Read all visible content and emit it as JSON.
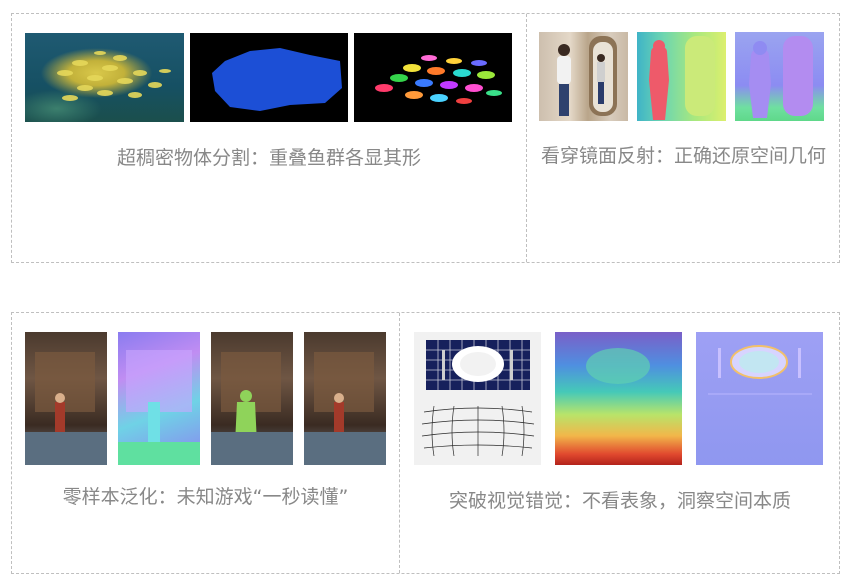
{
  "panels": {
    "dense_segmentation": {
      "caption": "超稠密物体分割：重叠鱼群各显其形"
    },
    "mirror_geometry": {
      "caption": "看穿镜面反射：正确还原空间几何"
    },
    "zero_shot_game": {
      "caption": "零样本泛化：未知游戏“一秒读懂”"
    },
    "visual_illusion": {
      "caption": "突破视觉错觉：不看表象，洞察空间本质"
    }
  },
  "colors": {
    "caption_text": "#888888",
    "border": "#bfbfbf",
    "background": "#ffffff"
  }
}
